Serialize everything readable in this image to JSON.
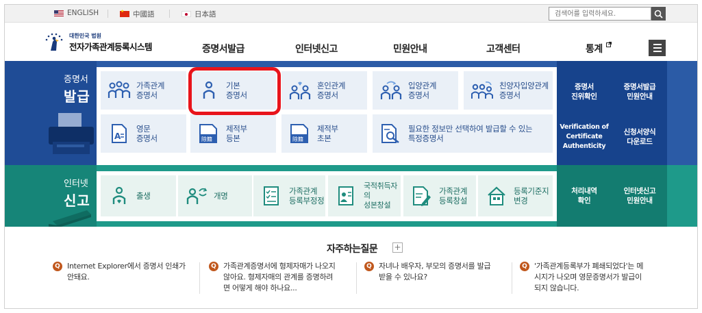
{
  "languages": [
    {
      "label": "ENGLISH",
      "flag": "us-flag-icon"
    },
    {
      "label": "中國語",
      "flag": "cn-flag-icon"
    },
    {
      "label": "日本語",
      "flag": "jp-flag-icon"
    }
  ],
  "search": {
    "placeholder": "검색어를 입력하세요."
  },
  "logo": {
    "small": "대한민국 법원",
    "title": "전자가족관계등록시스템"
  },
  "gnb": [
    "증명서발급",
    "인터넷신고",
    "민원안내",
    "고객센터",
    "통계"
  ],
  "issue": {
    "title_small": "증명서",
    "title_big": "발급",
    "tiles": [
      {
        "line1": "가족관계",
        "line2": "증명서",
        "icon": "family-icon"
      },
      {
        "line1": "기본",
        "line2": "증명서",
        "icon": "person-icon"
      },
      {
        "line1": "혼인관계",
        "line2": "증명서",
        "icon": "marriage-icon"
      },
      {
        "line1": "입양관계",
        "line2": "증명서",
        "icon": "adoption-icon"
      },
      {
        "line1": "친양자입양관계",
        "line2": "증명서",
        "icon": "full-adoption-icon"
      },
      {
        "line1": "영문",
        "line2": "증명서",
        "icon": "english-document-icon"
      },
      {
        "line1": "제적부",
        "line2": "등본",
        "icon": "removed-register-icon"
      },
      {
        "line1": "제적부",
        "line2": "초본",
        "icon": "removed-register-extract-icon"
      },
      {
        "line1": "필요한 정보만 선택하여 발급할 수 있는",
        "line2": "특정증명서",
        "icon": "document-search-icon"
      }
    ],
    "side": [
      {
        "line1": "증명서",
        "line2": "진위확인"
      },
      {
        "line1": "증명서발급",
        "line2": "민원안내"
      },
      {
        "line1": "Verification of",
        "line2": "Certificate",
        "line3": "Authenticity"
      },
      {
        "line1": "신청서양식",
        "line2": "다운로드"
      }
    ],
    "accent": "#2b5ba6"
  },
  "report": {
    "title_small": "인터넷",
    "title_big": "신고",
    "tiles": [
      {
        "line1": "출생",
        "line2": "",
        "icon": "birth-icon"
      },
      {
        "line1": "개명",
        "line2": "",
        "icon": "rename-icon"
      },
      {
        "line1": "가족관계",
        "line2": "등록부정정",
        "icon": "correction-form-icon"
      },
      {
        "line1": "국적취득자의",
        "line2": "성본창설",
        "icon": "id-card-icon"
      },
      {
        "line1": "가족관계",
        "line2": "등록창설",
        "icon": "document-edit-icon"
      },
      {
        "line1": "등록기준지",
        "line2": "변경",
        "icon": "house-icon"
      }
    ],
    "side": [
      {
        "line1": "처리내역",
        "line2": "확인"
      },
      {
        "line1": "인터넷신고",
        "line2": "민원안내"
      }
    ],
    "accent": "#1e9a8a"
  },
  "faq": {
    "title": "자주하는질문",
    "plus": "+",
    "badge": "Q",
    "items": [
      {
        "line1": "Internet Explorer에서 증명서 인쇄가",
        "line2": "안돼요.",
        "line3": ""
      },
      {
        "line1": "가족관계증명서에 형제자매가 나오지",
        "line2": "않아요. 형제자매의 관계를 증명하려",
        "line3": "면 어떻게 해야 하나요..."
      },
      {
        "line1": "자녀나 배우자, 부모의 증명서를 발급",
        "line2": "받을 수 있나요?",
        "line3": ""
      },
      {
        "line1": "'가족관계등록부가 폐쇄되었다'는 메",
        "line2": "시지가 나오며 영문증명서가 발급이",
        "line3": "되지 않습니다."
      }
    ]
  },
  "highlight_color": "#e8141b"
}
